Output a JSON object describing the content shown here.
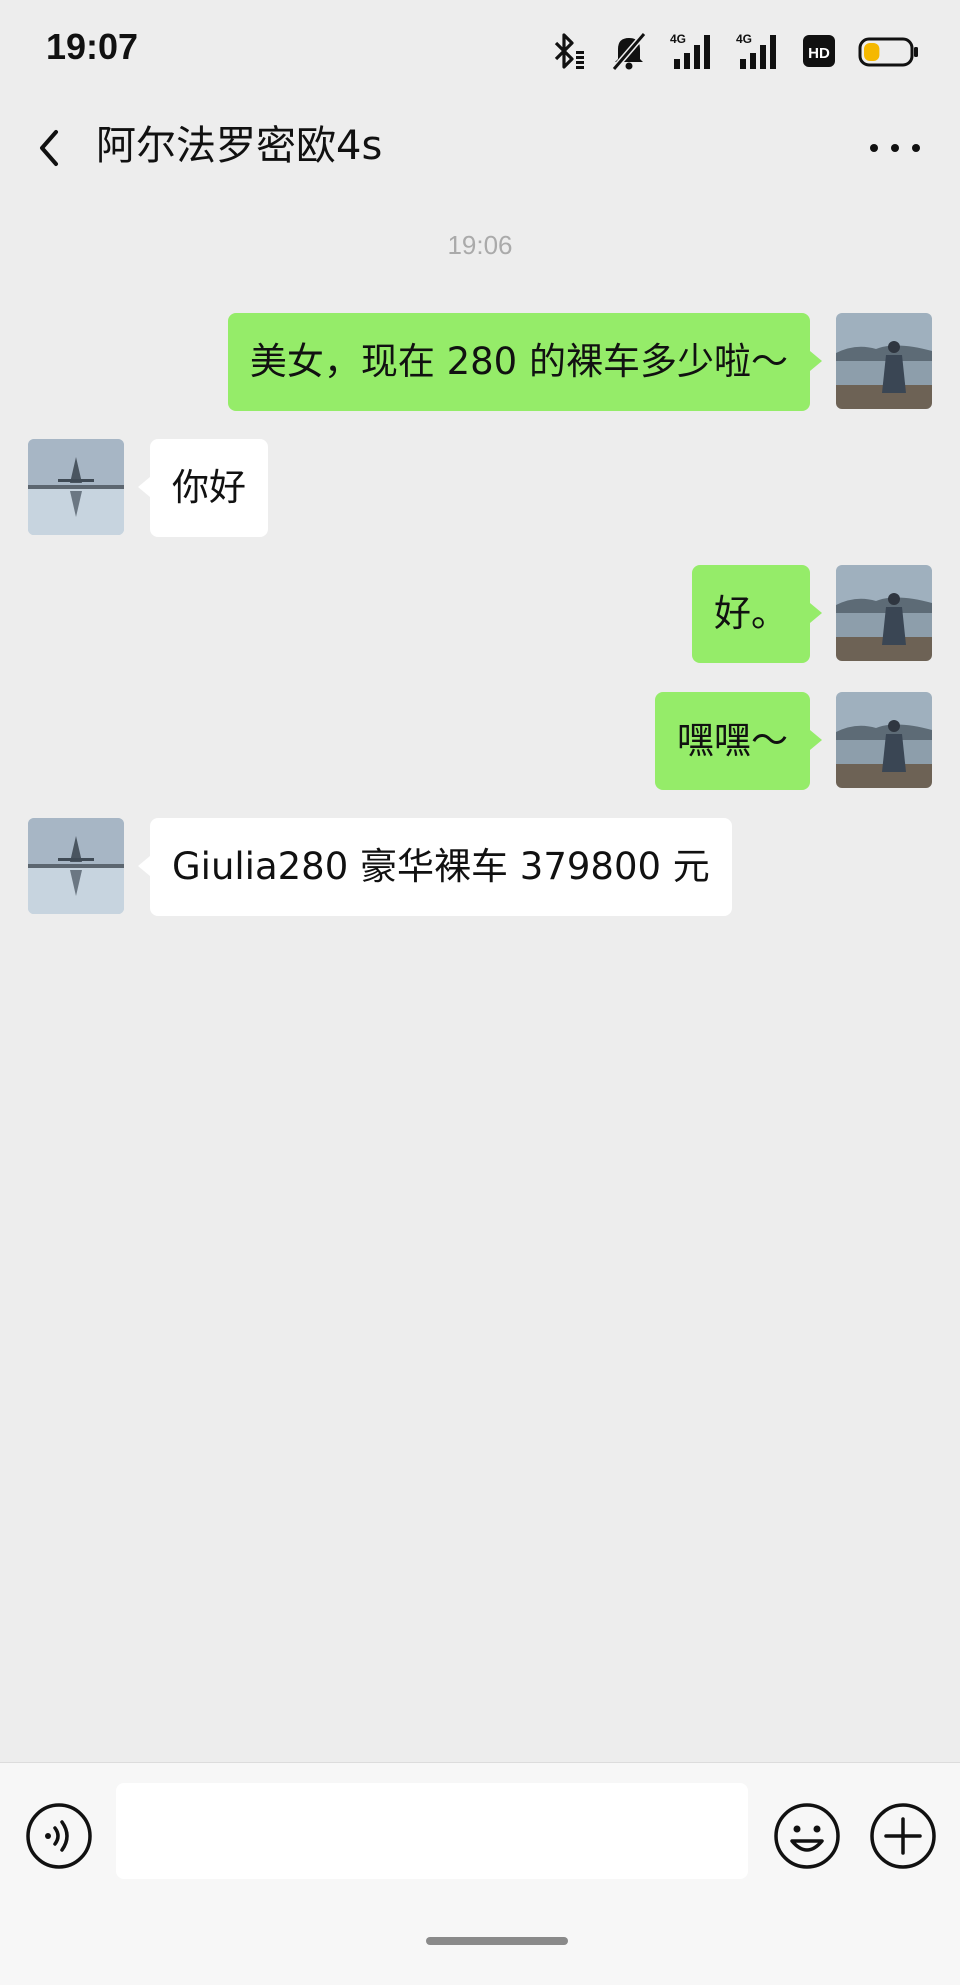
{
  "status_bar": {
    "time": "19:07",
    "icons": [
      "bluetooth-icon",
      "mute-icon",
      "signal-4g-icon",
      "signal-4g-icon",
      "hd-icon",
      "battery-icon"
    ],
    "network_labels": [
      "4G",
      "4G"
    ],
    "hd_label": "HD",
    "battery_level": 0.35,
    "battery_color": "#f5b800"
  },
  "header": {
    "title": "阿尔法罗密欧4s"
  },
  "chat": {
    "timestamp": "19:06",
    "messages": [
      {
        "side": "sent",
        "text": "美女，现在 280 的裸车多少啦～"
      },
      {
        "side": "received",
        "text": "你好"
      },
      {
        "side": "sent",
        "text": "好。"
      },
      {
        "side": "sent",
        "text": "嘿嘿～"
      },
      {
        "side": "received",
        "text": "Giulia280 豪华裸车 379800 元"
      }
    ]
  },
  "input_bar": {
    "value": "",
    "icons": [
      "voice-icon",
      "emoji-icon",
      "plus-icon"
    ]
  },
  "colors": {
    "background": "#ededed",
    "sent_bubble": "#95ec69",
    "received_bubble": "#ffffff",
    "timestamp_text": "#aaaaaa"
  }
}
